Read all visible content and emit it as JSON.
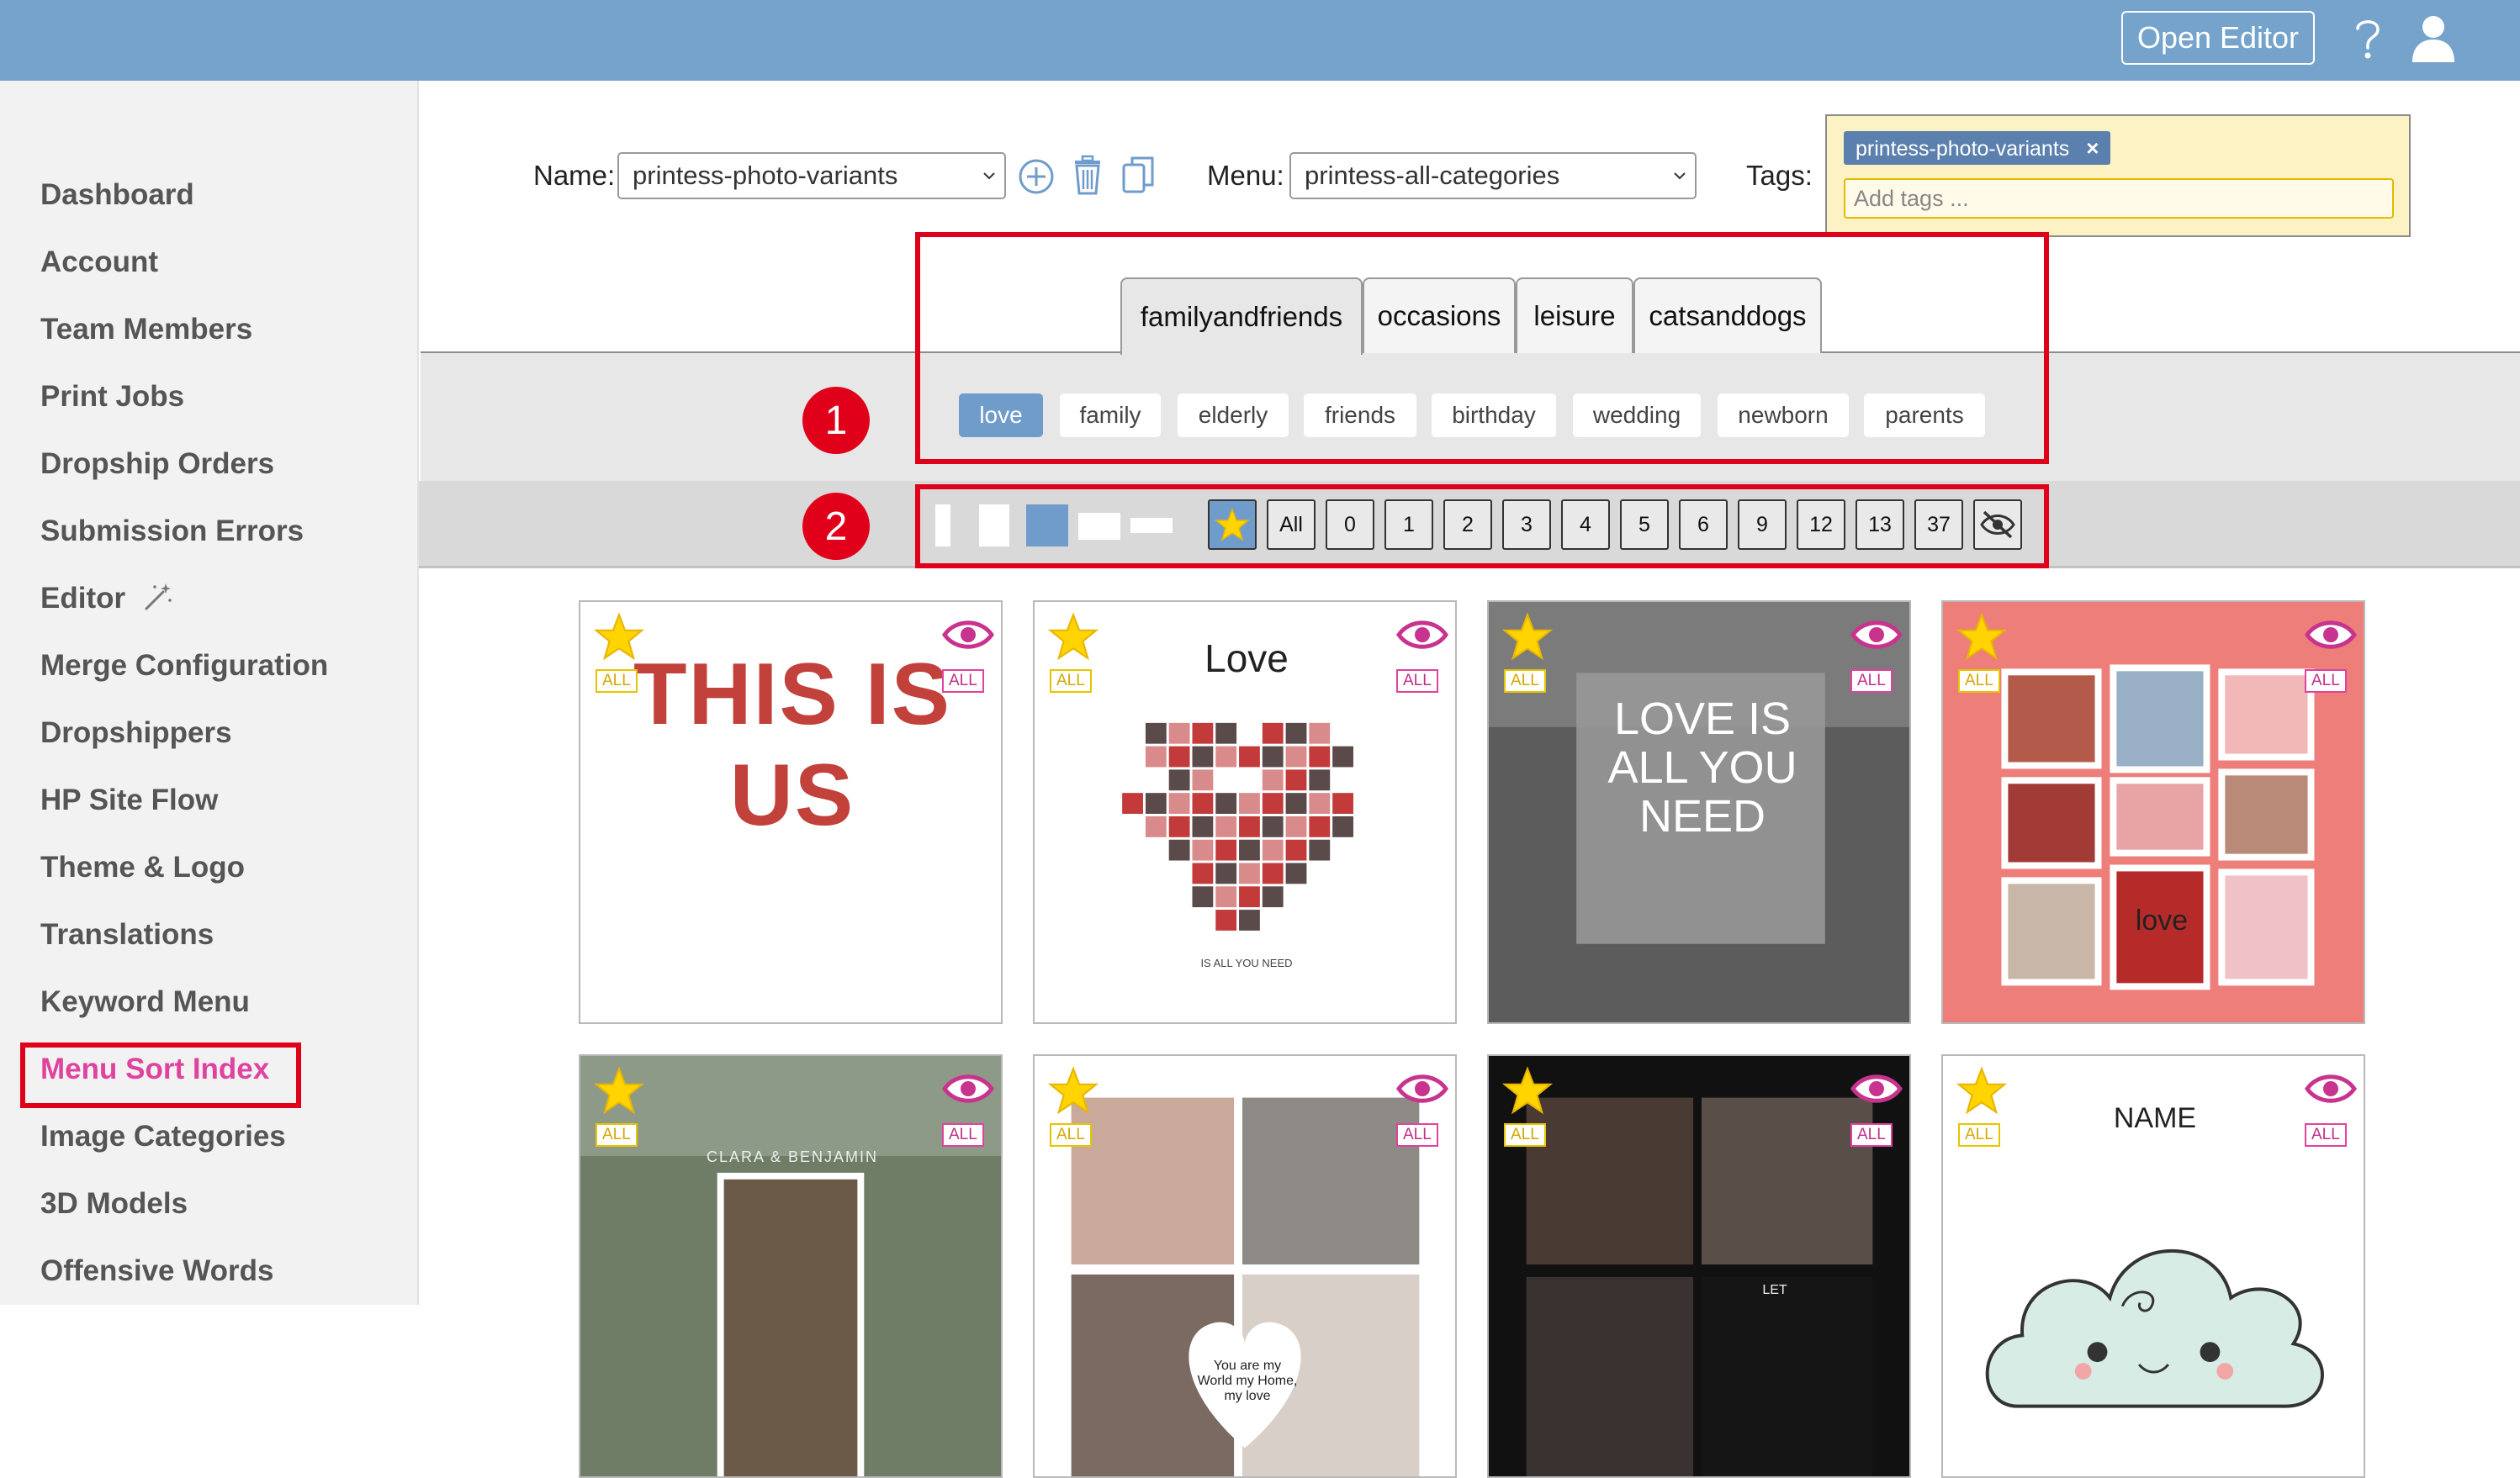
{
  "header": {
    "open_editor_label": "Open Editor",
    "help_icon": "question-mark-icon",
    "user_icon": "user-icon",
    "bg_color": "#75a3cc"
  },
  "sidebar": {
    "items": [
      {
        "label": "Dashboard"
      },
      {
        "label": "Account"
      },
      {
        "label": "Team Members"
      },
      {
        "label": "Print Jobs"
      },
      {
        "label": "Dropship Orders"
      },
      {
        "label": "Submission Errors"
      },
      {
        "label": "Editor",
        "icon": "magic-wand-icon"
      },
      {
        "label": "Merge Configuration"
      },
      {
        "label": "Dropshippers"
      },
      {
        "label": "HP Site Flow"
      },
      {
        "label": "Theme & Logo"
      },
      {
        "label": "Translations"
      },
      {
        "label": "Keyword Menu"
      },
      {
        "label": "Menu Sort Index",
        "active": true
      },
      {
        "label": "Image Categories"
      },
      {
        "label": "3D Models"
      },
      {
        "label": "Offensive Words"
      }
    ],
    "active_color": "#e0439f"
  },
  "toolbar": {
    "name_label": "Name:",
    "name_value": "printess-photo-variants",
    "menu_label": "Menu:",
    "menu_value": "printess-all-categories",
    "tags_label": "Tags:",
    "tag_chip": "printess-photo-variants",
    "tag_remove": "×",
    "tags_placeholder": "Add tags ...",
    "icons": [
      "add-circle-icon",
      "trash-icon",
      "copy-icon"
    ]
  },
  "tabs": [
    {
      "label": "familyandfriends",
      "active": true
    },
    {
      "label": "occasions"
    },
    {
      "label": "leisure"
    },
    {
      "label": "catsanddogs"
    }
  ],
  "subcategories": [
    {
      "label": "love",
      "active": true
    },
    {
      "label": "family"
    },
    {
      "label": "elderly"
    },
    {
      "label": "friends"
    },
    {
      "label": "birthday"
    },
    {
      "label": "wedding"
    },
    {
      "label": "newborn"
    },
    {
      "label": "parents"
    }
  ],
  "markers": [
    "1",
    "2"
  ],
  "filters": {
    "aspect_icons": [
      "aspect-tall-icon",
      "aspect-portrait-icon",
      "aspect-square-icon",
      "aspect-landscape-icon",
      "aspect-wide-icon"
    ],
    "selected_aspect": "aspect-square-icon",
    "buttons": [
      "All",
      "0",
      "1",
      "2",
      "3",
      "4",
      "5",
      "6",
      "9",
      "12",
      "13",
      "37"
    ],
    "star_icon": "star-icon",
    "hide_icon": "eye-slash-icon"
  },
  "templates": [
    {
      "text": "THIS IS US",
      "sub": "",
      "badge_left": "ALL",
      "badge_right": "ALL"
    },
    {
      "text": "Love",
      "sub": "IS ALL YOU NEED",
      "badge_left": "ALL",
      "badge_right": "ALL"
    },
    {
      "text": "LOVE IS ALL YOU NEED",
      "sub": "",
      "badge_left": "ALL",
      "badge_right": "ALL"
    },
    {
      "text": "love",
      "sub": "",
      "badge_left": "ALL",
      "badge_right": "ALL"
    },
    {
      "text": "CLARA & BENJAMIN",
      "sub": "",
      "badge_left": "ALL",
      "badge_right": "ALL"
    },
    {
      "text": "You are my World my Home, my love",
      "sub": "",
      "badge_left": "ALL",
      "badge_right": "ALL"
    },
    {
      "text": "LET",
      "sub": "",
      "badge_left": "ALL",
      "badge_right": "ALL"
    },
    {
      "text": "NAME",
      "sub": "",
      "badge_left": "ALL",
      "badge_right": "ALL"
    }
  ]
}
